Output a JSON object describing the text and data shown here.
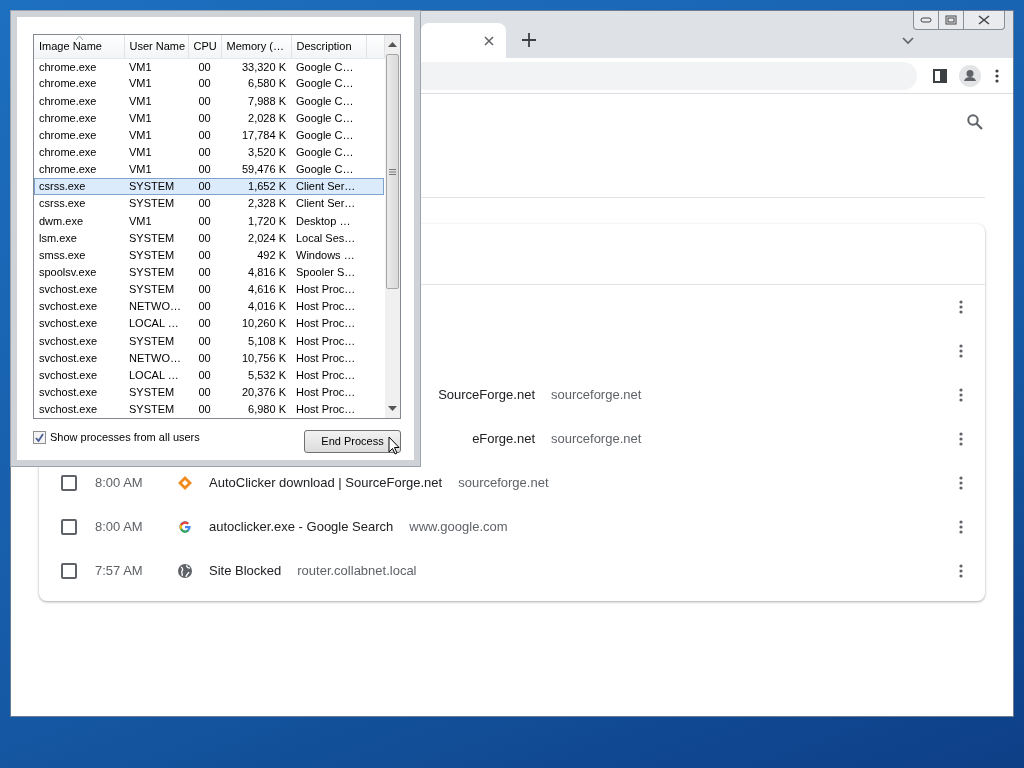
{
  "task_manager": {
    "columns": [
      "Image Name",
      "User Name",
      "CPU",
      "Memory (…",
      "Description"
    ],
    "rows": [
      {
        "image_name": "chrome.exe",
        "user_name": "VM1",
        "cpu": "00",
        "memory": "33,320 K",
        "description": "Google C…",
        "selected": false
      },
      {
        "image_name": "chrome.exe",
        "user_name": "VM1",
        "cpu": "00",
        "memory": "6,580 K",
        "description": "Google C…",
        "selected": false
      },
      {
        "image_name": "chrome.exe",
        "user_name": "VM1",
        "cpu": "00",
        "memory": "7,988 K",
        "description": "Google C…",
        "selected": false
      },
      {
        "image_name": "chrome.exe",
        "user_name": "VM1",
        "cpu": "00",
        "memory": "2,028 K",
        "description": "Google C…",
        "selected": false
      },
      {
        "image_name": "chrome.exe",
        "user_name": "VM1",
        "cpu": "00",
        "memory": "17,784 K",
        "description": "Google C…",
        "selected": false
      },
      {
        "image_name": "chrome.exe",
        "user_name": "VM1",
        "cpu": "00",
        "memory": "3,520 K",
        "description": "Google C…",
        "selected": false
      },
      {
        "image_name": "chrome.exe",
        "user_name": "VM1",
        "cpu": "00",
        "memory": "59,476 K",
        "description": "Google C…",
        "selected": false
      },
      {
        "image_name": "csrss.exe",
        "user_name": "SYSTEM",
        "cpu": "00",
        "memory": "1,652 K",
        "description": "Client Ser…",
        "selected": true
      },
      {
        "image_name": "csrss.exe",
        "user_name": "SYSTEM",
        "cpu": "00",
        "memory": "2,328 K",
        "description": "Client Ser…",
        "selected": false
      },
      {
        "image_name": "dwm.exe",
        "user_name": "VM1",
        "cpu": "00",
        "memory": "1,720 K",
        "description": "Desktop …",
        "selected": false
      },
      {
        "image_name": "lsm.exe",
        "user_name": "SYSTEM",
        "cpu": "00",
        "memory": "2,024 K",
        "description": "Local Ses…",
        "selected": false
      },
      {
        "image_name": "smss.exe",
        "user_name": "SYSTEM",
        "cpu": "00",
        "memory": "492 K",
        "description": "Windows …",
        "selected": false
      },
      {
        "image_name": "spoolsv.exe",
        "user_name": "SYSTEM",
        "cpu": "00",
        "memory": "4,816 K",
        "description": "Spooler S…",
        "selected": false
      },
      {
        "image_name": "svchost.exe",
        "user_name": "SYSTEM",
        "cpu": "00",
        "memory": "4,616 K",
        "description": "Host Proc…",
        "selected": false
      },
      {
        "image_name": "svchost.exe",
        "user_name": "NETWO…",
        "cpu": "00",
        "memory": "4,016 K",
        "description": "Host Proc…",
        "selected": false
      },
      {
        "image_name": "svchost.exe",
        "user_name": "LOCAL …",
        "cpu": "00",
        "memory": "10,260 K",
        "description": "Host Proc…",
        "selected": false
      },
      {
        "image_name": "svchost.exe",
        "user_name": "SYSTEM",
        "cpu": "00",
        "memory": "5,108 K",
        "description": "Host Proc…",
        "selected": false
      },
      {
        "image_name": "svchost.exe",
        "user_name": "NETWO…",
        "cpu": "00",
        "memory": "10,756 K",
        "description": "Host Proc…",
        "selected": false
      },
      {
        "image_name": "svchost.exe",
        "user_name": "LOCAL …",
        "cpu": "00",
        "memory": "5,532 K",
        "description": "Host Proc…",
        "selected": false
      },
      {
        "image_name": "svchost.exe",
        "user_name": "SYSTEM",
        "cpu": "00",
        "memory": "20,376 K",
        "description": "Host Proc…",
        "selected": false
      },
      {
        "image_name": "svchost.exe",
        "user_name": "SYSTEM",
        "cpu": "00",
        "memory": "6,980 K",
        "description": "Host Proc…",
        "selected": false
      }
    ],
    "show_all_users": {
      "label": "Show processes from all users",
      "checked": true
    },
    "end_button": "End Process"
  },
  "history": {
    "rows": [
      {
        "kind": "covered"
      },
      {
        "kind": "covered"
      },
      {
        "kind": "partial",
        "title": "SourceForge.net",
        "domain": "sourceforge.net"
      },
      {
        "kind": "partial",
        "title": "eForge.net",
        "domain": "sourceforge.net"
      },
      {
        "kind": "diamond",
        "checked": false,
        "time": "8:00 AM",
        "title": "AutoClicker download | SourceForge.net",
        "domain": "sourceforge.net"
      },
      {
        "kind": "g-letter",
        "checked": false,
        "time": "8:00 AM",
        "title": "autoclicker.exe - Google Search",
        "domain": "www.google.com"
      },
      {
        "kind": "globe",
        "checked": false,
        "time": "7:57 AM",
        "title": "Site Blocked",
        "domain": "router.collabnet.local"
      }
    ]
  }
}
